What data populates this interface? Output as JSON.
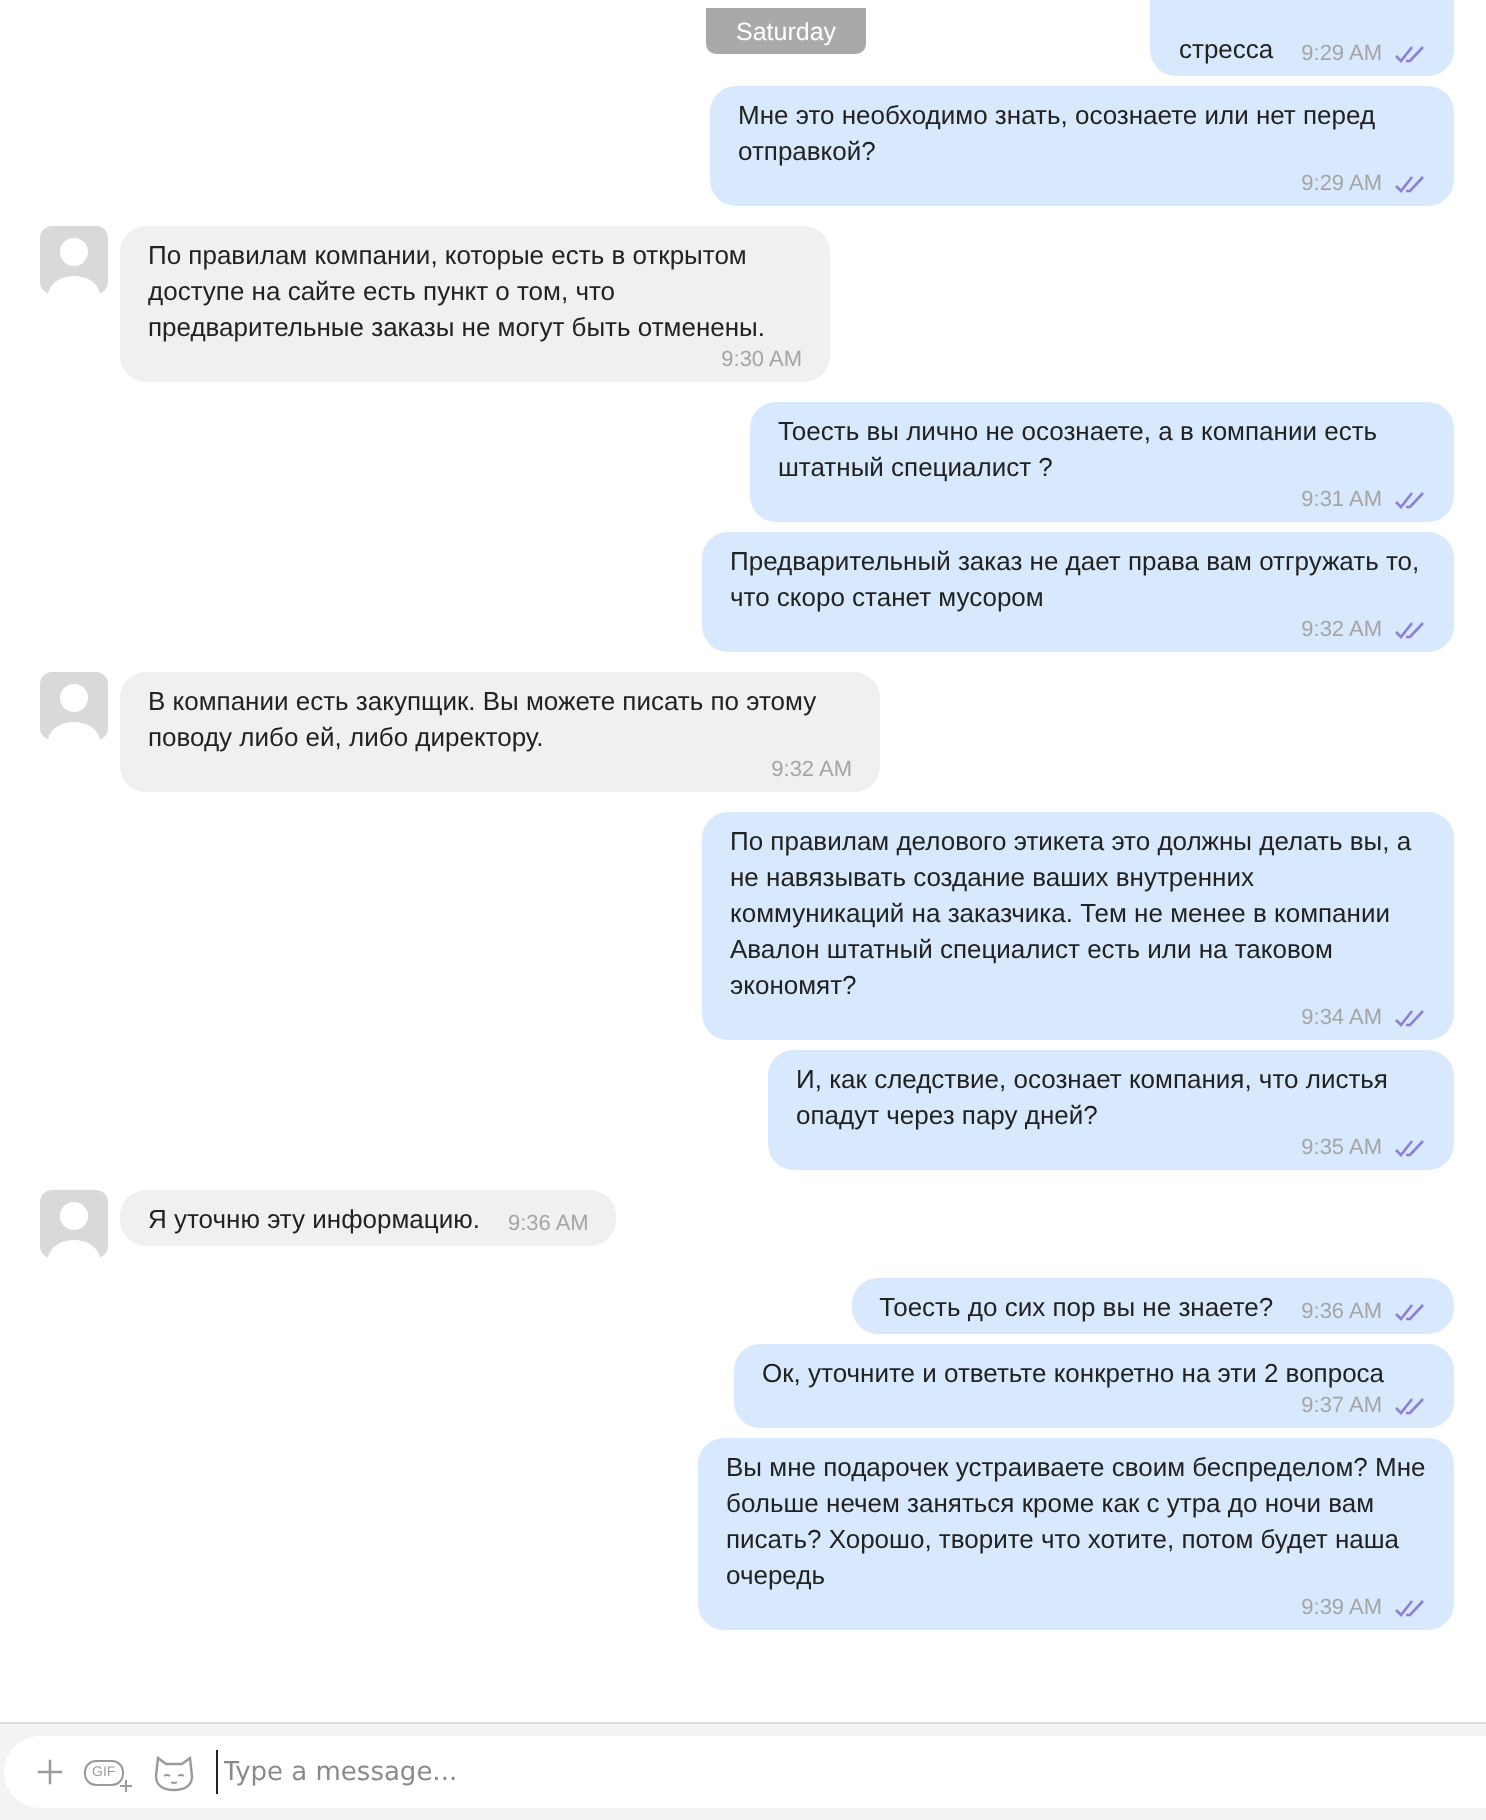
{
  "date_pill": "Saturday",
  "messages": [
    {
      "kind": "out",
      "text": "стресса",
      "time": "9:29 AM",
      "read": true
    },
    {
      "kind": "out",
      "text": "Мне это необходимо знать, осознаете или нет перед отправкой?",
      "time": "9:29 AM",
      "read": true
    },
    {
      "kind": "in",
      "text": "По правилам компании, которые есть в открытом доступе на сайте есть пункт о том, что предварительные заказы не могут быть отменены.",
      "time": "9:30 AM"
    },
    {
      "kind": "out",
      "text": "Тоесть вы лично не осознаете, а в компании есть штатный специалист ?",
      "time": "9:31 AM",
      "read": true
    },
    {
      "kind": "out",
      "text": "Предварительный заказ не дает права вам отгружать то, что скоро станет мусором",
      "time": "9:32 AM",
      "read": true
    },
    {
      "kind": "in",
      "text": "В компании есть закупщик. Вы можете писать по этому поводу либо ей, либо директору.",
      "time": "9:32 AM"
    },
    {
      "kind": "out",
      "text": "По правилам делового этикета это должны делать вы, а не навязывать создание ваших внутренних коммуникаций на заказчика. Тем не менее в компании Авалон штатный специалист есть или на таковом экономят?",
      "time": "9:34 AM",
      "read": true
    },
    {
      "kind": "out",
      "text": "И, как следствие, осознает компания, что листья опадут через пару дней?",
      "time": "9:35 AM",
      "read": true
    },
    {
      "kind": "in",
      "text": "Я уточню эту информацию.",
      "time": "9:36 AM"
    },
    {
      "kind": "out",
      "text": "Тоесть до сих пор вы не знаете?",
      "time": "9:36 AM",
      "read": true
    },
    {
      "kind": "out",
      "text": "Ок, уточните и ответьте конкретно на эти 2 вопроса",
      "time": "9:37 AM",
      "read": true
    },
    {
      "kind": "out",
      "text": "Вы мне подарочек устраиваете своим беспределом? Мне больше нечем заняться кроме как с утра до ночи вам писать? Хорошо, творите что хотите, потом будет наша очередь",
      "time": "9:39 AM",
      "read": true
    }
  ],
  "composer": {
    "gif_label": "GIF",
    "placeholder": "Type a message..."
  }
}
